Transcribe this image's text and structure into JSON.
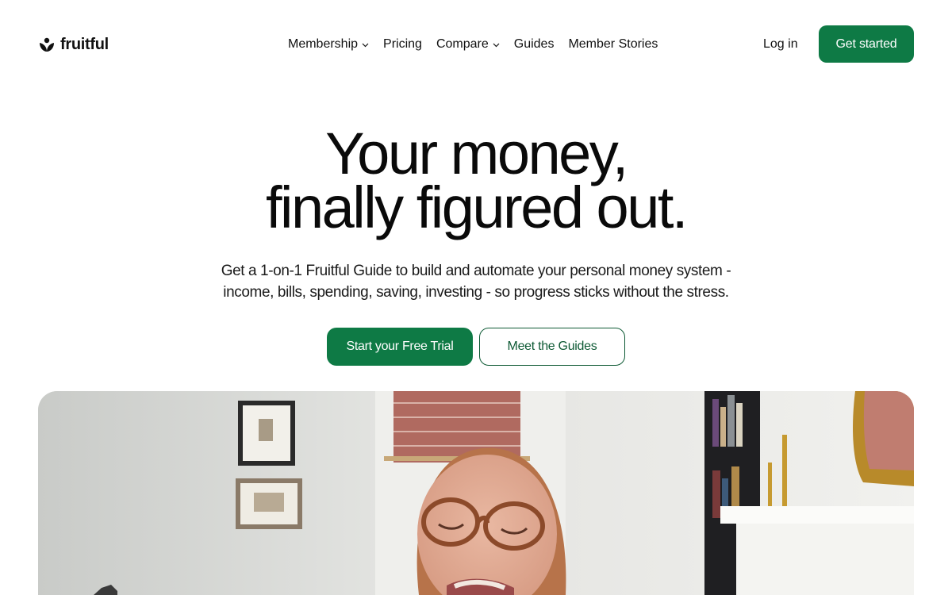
{
  "brand": {
    "name": "fruitful",
    "logo_icon": "fruitful-leaf-logo-icon",
    "accent_color": "#0e7a45"
  },
  "nav": {
    "items": [
      {
        "label": "Membership",
        "has_dropdown": true
      },
      {
        "label": "Pricing",
        "has_dropdown": false
      },
      {
        "label": "Compare",
        "has_dropdown": true
      },
      {
        "label": "Guides",
        "has_dropdown": false
      },
      {
        "label": "Member Stories",
        "has_dropdown": false
      }
    ],
    "login_label": "Log in",
    "cta_label": "Get started"
  },
  "hero": {
    "title_line1": "Your money,",
    "title_line2": "finally figured out.",
    "subtitle_line1": "Get a 1-on-1 Fruitful Guide to build and automate your personal money system -",
    "subtitle_line2": "income, bills, spending, saving, investing - so progress sticks without the stress.",
    "primary_cta": "Start your Free Trial",
    "secondary_cta": "Meet the Guides"
  },
  "media": {
    "type": "video-thumbnail",
    "subject": "woman-with-glasses-in-living-room"
  }
}
